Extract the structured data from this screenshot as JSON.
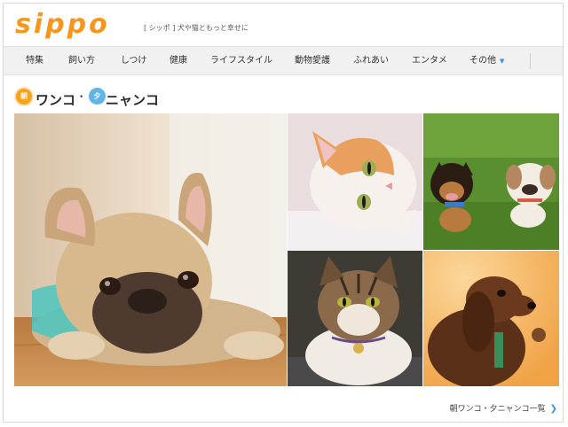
{
  "header": {
    "logo_text": "sippo",
    "tagline": "[ シッポ ] 犬や猫ともっと幸せに"
  },
  "nav": {
    "items": [
      {
        "label": "特集"
      },
      {
        "label": "飼い方"
      },
      {
        "label": "しつけ"
      },
      {
        "label": "健康"
      },
      {
        "label": "ライフスタイル"
      },
      {
        "label": "動物愛護"
      },
      {
        "label": "ふれあい"
      },
      {
        "label": "エンタメ"
      },
      {
        "label": "その他"
      }
    ],
    "more_caret_icon": "caret-down-icon"
  },
  "section": {
    "sun_char": "朝",
    "title_part1": "ワンコ",
    "dot": "•",
    "moon_char": "夕",
    "title_part2": "ニャンコ"
  },
  "photos": [
    {
      "subject": "french-bulldog-lying-on-floor"
    },
    {
      "subject": "white-orange-cat-lying"
    },
    {
      "subject": "two-small-dogs-on-grass"
    },
    {
      "subject": "tabby-cat-with-bell-collar"
    },
    {
      "subject": "dachshund-on-orange-background"
    }
  ],
  "footer": {
    "more_link": "朝ワンコ・夕ニャンコ一覧",
    "arrow_icon": "chevron-right-icon"
  },
  "colors": {
    "logo": "#f5961f",
    "nav_bg": "#f1f1f1",
    "accent_blue": "#3d8fd6",
    "sun": "#f7a21b",
    "moon": "#61b4e8"
  }
}
